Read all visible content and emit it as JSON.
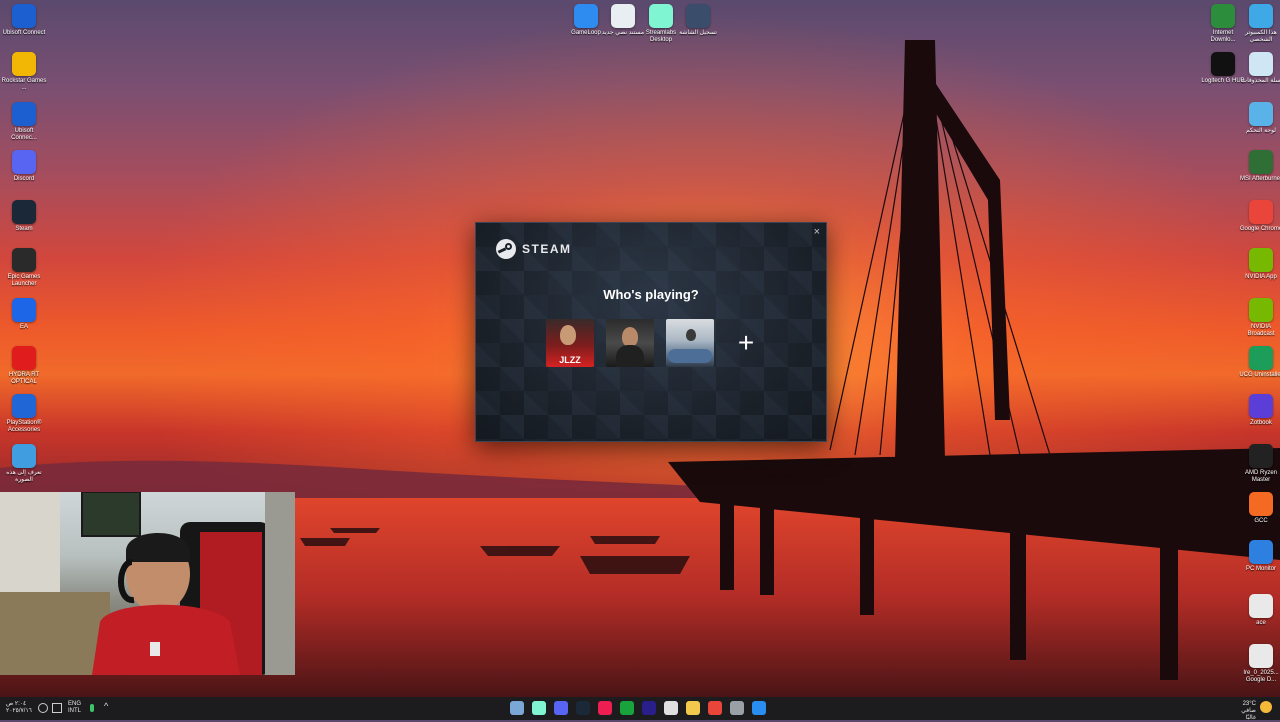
{
  "desktop_left": [
    {
      "label": "Ubisoft Connect",
      "icon": "ubisoft-icon",
      "color": "#1b5fd1"
    },
    {
      "label": "Rockstar Games ...",
      "icon": "rockstar-icon",
      "color": "#f2b705"
    },
    {
      "label": "Ubisoft Connec...",
      "icon": "ubisoft-icon",
      "color": "#1b5fd1"
    },
    {
      "label": "Discord",
      "icon": "discord-icon",
      "color": "#5865f2"
    },
    {
      "label": "Steam",
      "icon": "steam-icon",
      "color": "#1b2838"
    },
    {
      "label": "Epic Games Launcher",
      "icon": "epic-icon",
      "color": "#2a2a2a"
    },
    {
      "label": "EA",
      "icon": "ea-icon",
      "color": "#1e66e8"
    },
    {
      "label": "HYDRA RT OPTICAL",
      "icon": "hydra-icon",
      "color": "#e11c1c"
    },
    {
      "label": "PlayStation® Accessories",
      "icon": "playstation-icon",
      "color": "#2166d6"
    },
    {
      "label": "تعرف إلى هذه الصورة",
      "icon": "info-icon",
      "color": "#3f9de0"
    }
  ],
  "desktop_top": [
    {
      "label": "GameLoop",
      "icon": "gameloop-icon",
      "color": "#2e8cf0"
    },
    {
      "label": "مستند نصي جديد",
      "icon": "document-icon",
      "color": "#e9eef3"
    },
    {
      "label": "Streamlabs Desktop",
      "icon": "streamlabs-icon",
      "color": "#80f5d2"
    },
    {
      "label": "تسجيل الشاشة",
      "icon": "screen-record-icon",
      "color": "#3a4e6b"
    }
  ],
  "desktop_right": [
    {
      "label": "Internet Downlo...",
      "icon": "idm-icon",
      "color": "#2c8e3c"
    },
    {
      "label": "هذا الكمبيوتر الشخصي",
      "icon": "this-pc-icon",
      "color": "#3fa9e8"
    },
    {
      "label": "Logitech G HUB",
      "icon": "logitech-icon",
      "color": "#111111"
    },
    {
      "label": "سلة المحذوفات",
      "icon": "recycle-bin-icon",
      "color": "#cfe6f5"
    },
    {
      "label": "لوحة التحكم",
      "icon": "control-panel-icon",
      "color": "#5ab3e8"
    },
    {
      "label": "MSI Afterburner",
      "icon": "msi-icon",
      "color": "#2f6e35"
    },
    {
      "label": "Google Chrome",
      "icon": "chrome-icon",
      "color": "#e9453a"
    },
    {
      "label": "NVIDIA App",
      "icon": "nvidia-icon",
      "color": "#76b900"
    },
    {
      "label": "NVIDIA Broadcast",
      "icon": "nvidia-broadcast-icon",
      "color": "#76b900"
    },
    {
      "label": "UCG Uninstaller",
      "icon": "uninstaller-icon",
      "color": "#1c9e5a"
    },
    {
      "label": "Zotbook",
      "icon": "zotbook-icon",
      "color": "#5b3ed8"
    },
    {
      "label": "AMD Ryzen Master",
      "icon": "amd-icon",
      "color": "#222222"
    },
    {
      "label": "GCC",
      "icon": "gcc-icon",
      "color": "#f46a22"
    },
    {
      "label": "PC Monitor",
      "icon": "pc-monitor-icon",
      "color": "#2d7fe0"
    },
    {
      "label": "ace",
      "icon": "file-icon",
      "color": "#e9e9e9"
    },
    {
      "label": "Ire_0_2025... Google D...",
      "icon": "file-icon",
      "color": "#e9e9e9"
    }
  ],
  "steam": {
    "brand": "STEAM",
    "heading": "Who's playing?",
    "close": "×",
    "profiles": [
      {
        "name": "profile-1",
        "overlay_text": "JLZZ"
      },
      {
        "name": "profile-2",
        "overlay_text": ""
      },
      {
        "name": "profile-3",
        "overlay_text": ""
      }
    ],
    "add_label": "+"
  },
  "taskbar": {
    "left_clock": {
      "time": "٢:٠٤ ص",
      "date": "٢٠٢٥/٧/١٦"
    },
    "lang": "ENG",
    "lang_sub": "INTL",
    "weather": {
      "temp": "23°C",
      "desc": "صافي غالبًا"
    },
    "apps": [
      "explorer-icon",
      "streamlabs-icon",
      "discord-icon",
      "steam-icon",
      "tiktok-icon",
      "xbox-icon",
      "premiere-icon",
      "calendar-icon",
      "files-icon",
      "chrome-icon",
      "terminal-icon",
      "start-icon"
    ]
  }
}
